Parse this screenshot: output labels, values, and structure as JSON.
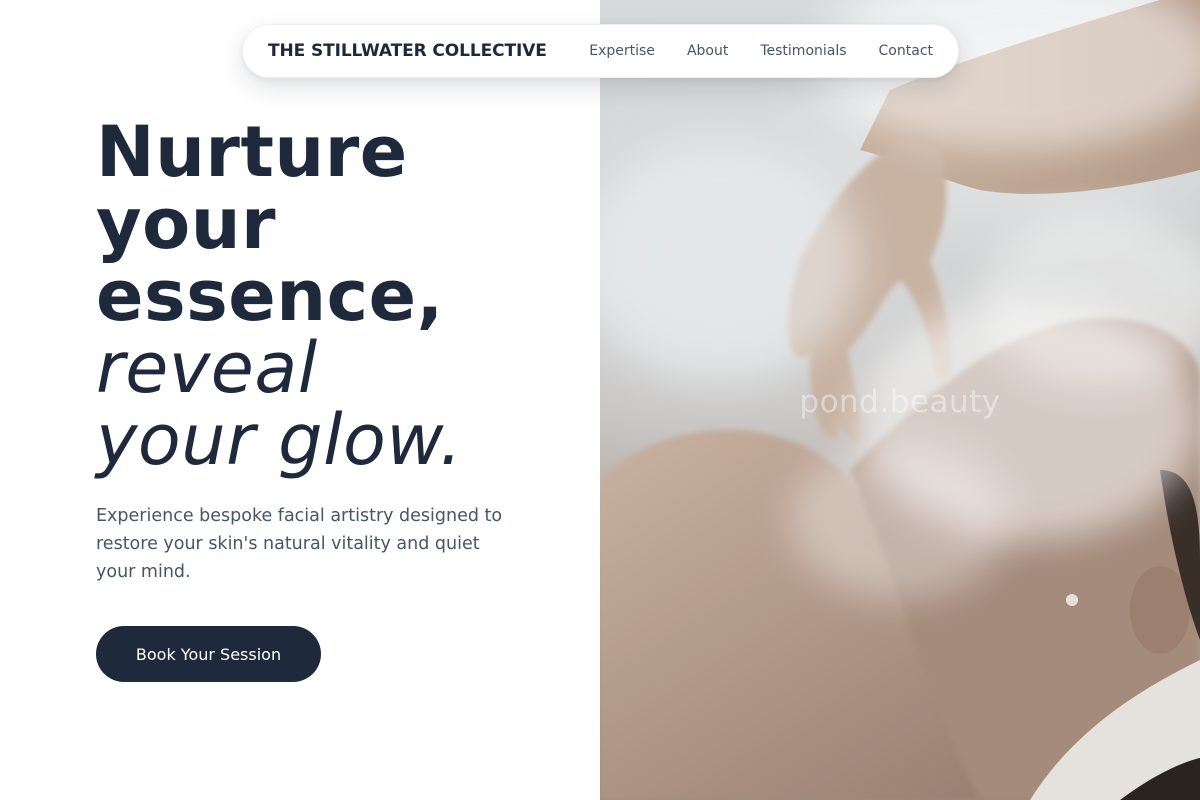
{
  "nav": {
    "brand": "THE STILLWATER COLLECTIVE",
    "links": [
      {
        "label": "Expertise"
      },
      {
        "label": "About"
      },
      {
        "label": "Testimonials"
      },
      {
        "label": "Contact"
      }
    ]
  },
  "hero": {
    "headline_strong": [
      "Nurture",
      "your",
      "essence,"
    ],
    "headline_soft": [
      "reveal",
      "your glow."
    ],
    "description": "Experience bespoke facial artistry designed to restore your skin's natural vitality and quiet your mind.",
    "cta_label": "Book Your Session"
  },
  "image": {
    "watermark": "pond.beauty"
  },
  "colors": {
    "ink": "#1e293b",
    "muted": "#475569",
    "background": "#ffffff",
    "button": "#1e293b"
  }
}
